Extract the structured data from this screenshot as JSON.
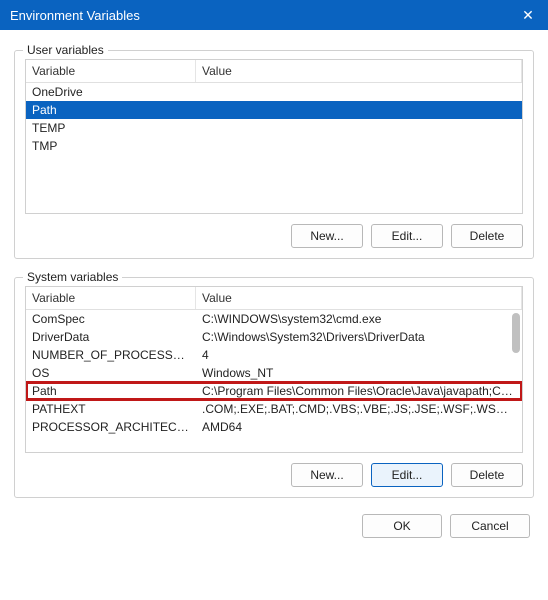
{
  "window": {
    "title": "Environment Variables",
    "close_glyph": "✕"
  },
  "user_section": {
    "legend": "User variables",
    "col_variable": "Variable",
    "col_value": "Value",
    "rows": [
      {
        "variable": "OneDrive",
        "value": ""
      },
      {
        "variable": "Path",
        "value": ""
      },
      {
        "variable": "TEMP",
        "value": ""
      },
      {
        "variable": "TMP",
        "value": ""
      }
    ],
    "selected_index": 1,
    "buttons": {
      "new": "New...",
      "edit": "Edit...",
      "delete": "Delete"
    }
  },
  "system_section": {
    "legend": "System variables",
    "col_variable": "Variable",
    "col_value": "Value",
    "rows": [
      {
        "variable": "ComSpec",
        "value": "C:\\WINDOWS\\system32\\cmd.exe"
      },
      {
        "variable": "DriverData",
        "value": "C:\\Windows\\System32\\Drivers\\DriverData"
      },
      {
        "variable": "NUMBER_OF_PROCESSORS",
        "value": "4"
      },
      {
        "variable": "OS",
        "value": "Windows_NT"
      },
      {
        "variable": "Path",
        "value": "C:\\Program Files\\Common Files\\Oracle\\Java\\javapath;C:\\WIN..."
      },
      {
        "variable": "PATHEXT",
        "value": ".COM;.EXE;.BAT;.CMD;.VBS;.VBE;.JS;.JSE;.WSF;.WSH;.MSC"
      },
      {
        "variable": "PROCESSOR_ARCHITECTU...",
        "value": "AMD64"
      }
    ],
    "highlighted_index": 4,
    "buttons": {
      "new": "New...",
      "edit": "Edit...",
      "delete": "Delete"
    }
  },
  "footer": {
    "ok": "OK",
    "cancel": "Cancel"
  }
}
